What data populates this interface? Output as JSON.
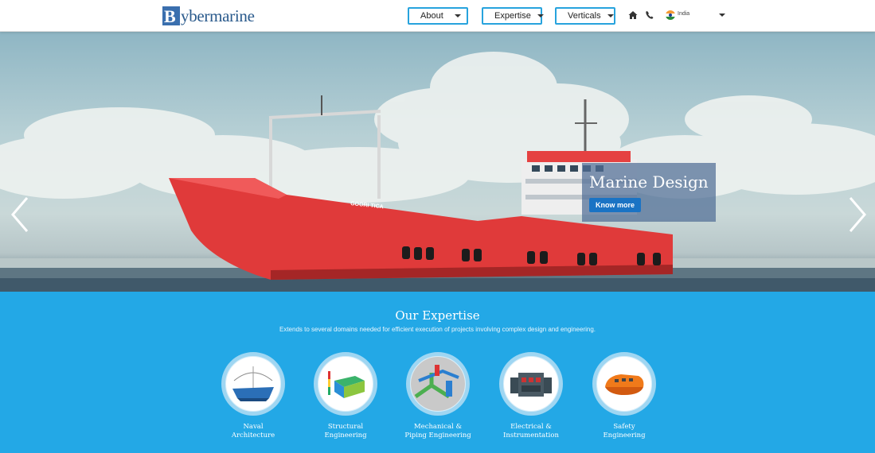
{
  "header": {
    "logo_text": "ybermarine",
    "logo_letter": "B",
    "nav": [
      {
        "label": "About"
      },
      {
        "label": "Expertise"
      },
      {
        "label": "Verticals"
      }
    ],
    "icons": [
      "home-icon",
      "phone-icon",
      "india-flag-icon"
    ],
    "country": "India"
  },
  "hero": {
    "caption_title": "Marine Design",
    "button_label": "Know more",
    "ship_name": "GOORI TICA"
  },
  "expertise": {
    "title": "Our Expertise",
    "subtitle": "Extends to several domains needed for efficient execution of projects involving complex design and engineering.",
    "items": [
      {
        "line1": "Naval",
        "line2": "Architecture",
        "icon": "ship-hull-icon"
      },
      {
        "line1": "Structural",
        "line2": "Engineering",
        "icon": "fem-model-icon"
      },
      {
        "line1": "Mechanical &",
        "line2": "Piping Engineering",
        "icon": "piping-icon"
      },
      {
        "line1": "Electrical &",
        "line2": "Instrumentation",
        "icon": "electrical-panel-icon"
      },
      {
        "line1": "Safety",
        "line2": "Engineering",
        "icon": "lifeboat-icon"
      }
    ]
  },
  "colors": {
    "accent": "#23a8e6",
    "nav_border": "#27a3dd",
    "hull": "#e03a3a",
    "button": "#1a73c4"
  }
}
